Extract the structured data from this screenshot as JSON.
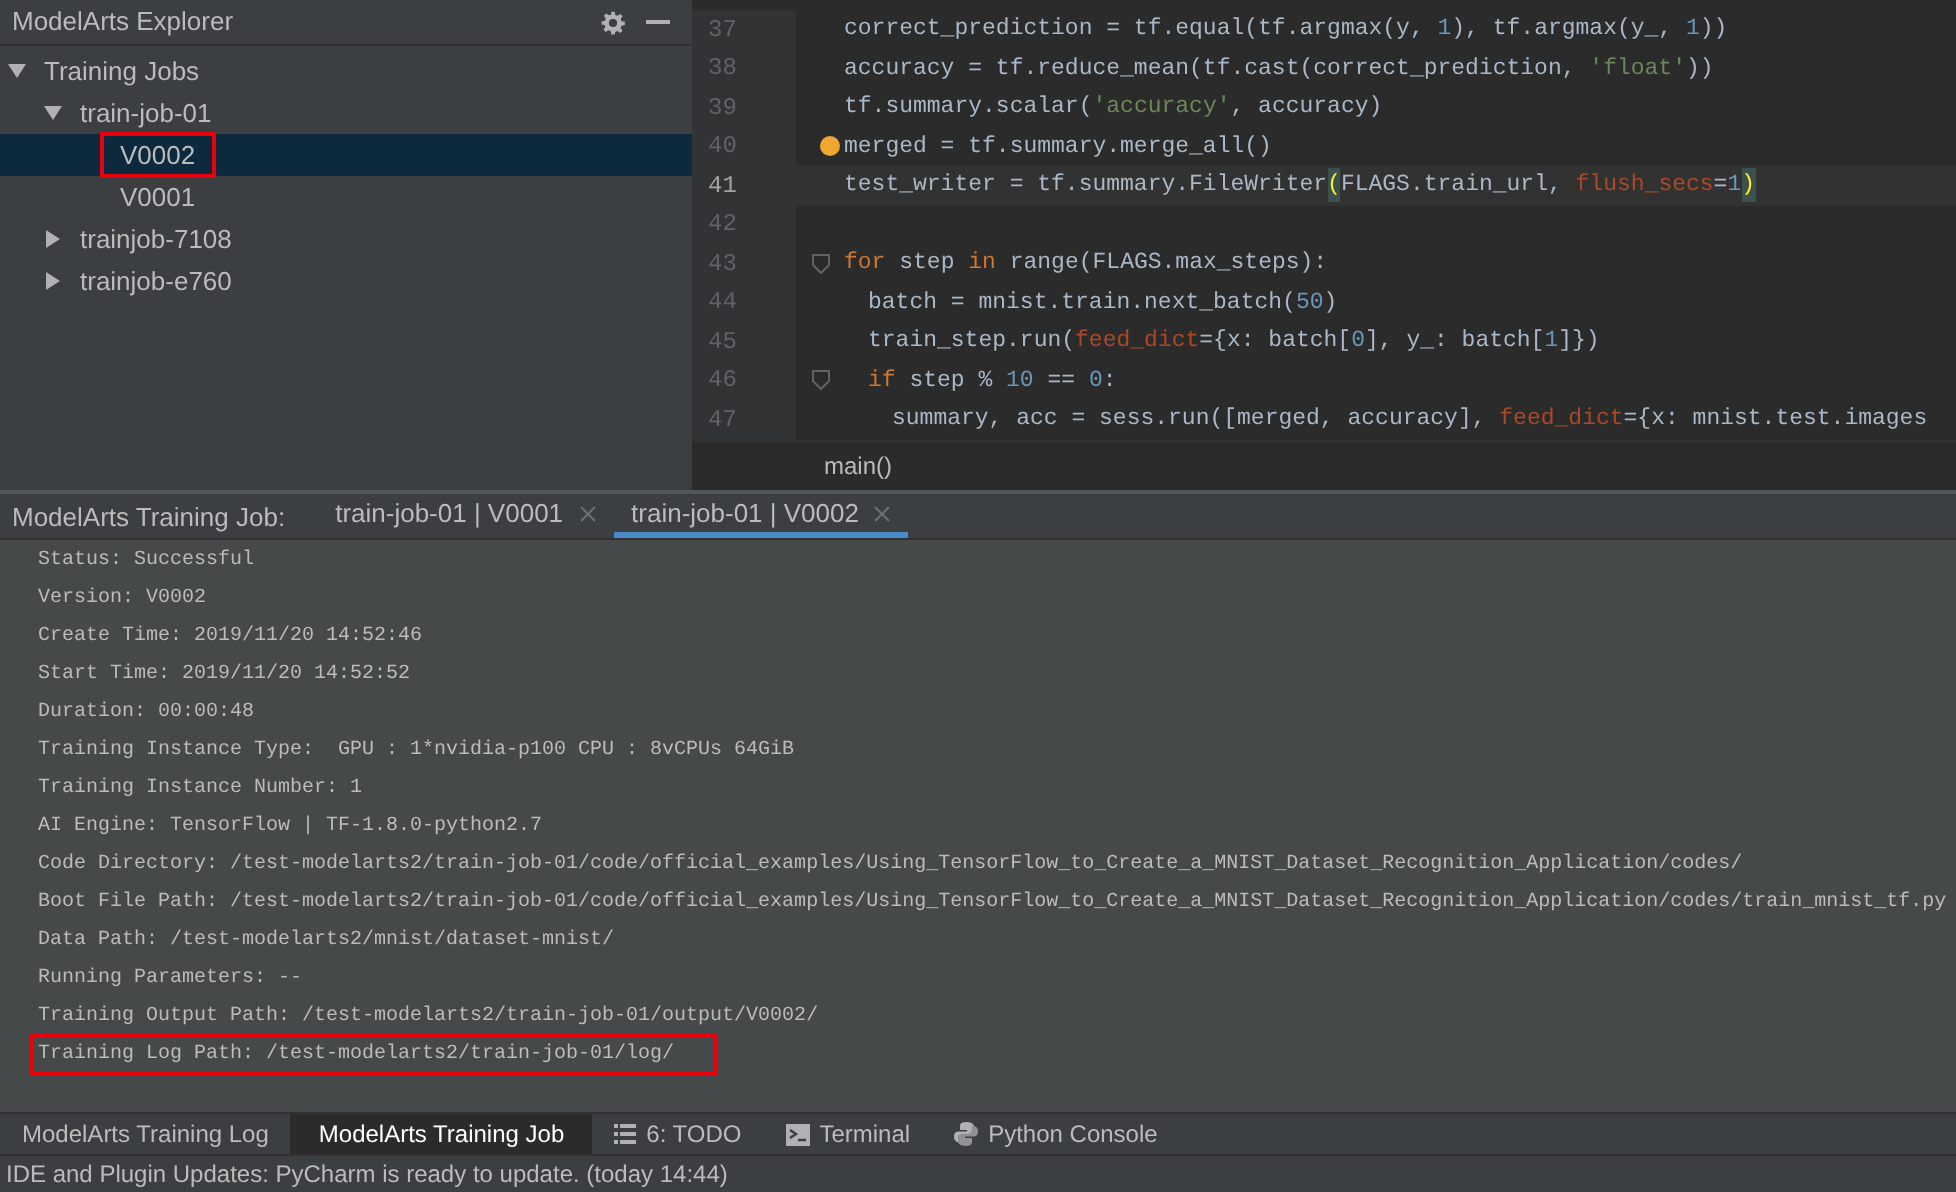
{
  "explorer": {
    "title": "ModelArts Explorer",
    "tree": [
      {
        "label": "Training Jobs",
        "expanded": true,
        "children": [
          {
            "label": "train-job-01",
            "expanded": true,
            "children": [
              {
                "label": "V0002",
                "selected": true,
                "annotated": true
              },
              {
                "label": "V0001",
                "selected": false,
                "annotated": false
              }
            ]
          },
          {
            "label": "trainjob-7108",
            "expanded": false
          },
          {
            "label": "trainjob-e760",
            "expanded": false
          }
        ]
      }
    ]
  },
  "editor": {
    "lines": [
      {
        "number": "37",
        "current": false,
        "bulb": false,
        "tokens": [
          {
            "kind": "plain",
            "text": "correct_prediction = tf.equal(tf.argmax(y, "
          },
          {
            "kind": "number",
            "text": "1"
          },
          {
            "kind": "plain",
            "text": "), tf.argmax(y_, "
          },
          {
            "kind": "number",
            "text": "1"
          },
          {
            "kind": "plain",
            "text": "))"
          }
        ]
      },
      {
        "number": "38",
        "current": false,
        "bulb": false,
        "tokens": [
          {
            "kind": "plain",
            "text": "accuracy = tf.reduce_mean(tf.cast(correct_prediction, "
          },
          {
            "kind": "string",
            "text": "'float'"
          },
          {
            "kind": "plain",
            "text": "))"
          }
        ]
      },
      {
        "number": "39",
        "current": false,
        "bulb": false,
        "tokens": [
          {
            "kind": "plain",
            "text": "tf.summary.scalar("
          },
          {
            "kind": "string",
            "text": "'accuracy'"
          },
          {
            "kind": "plain",
            "text": ", accuracy)"
          }
        ]
      },
      {
        "number": "40",
        "current": false,
        "bulb": true,
        "tokens": [
          {
            "kind": "plain",
            "text": "merged = tf.summary.merge_all()"
          }
        ]
      },
      {
        "number": "41",
        "current": true,
        "bulb": false,
        "tokens": [
          {
            "kind": "plain",
            "text": "test_writer = tf.summary.FileWriter"
          },
          {
            "kind": "brace",
            "text": "("
          },
          {
            "kind": "plain",
            "text": "FLAGS.train_url, "
          },
          {
            "kind": "param",
            "text": "flush_secs"
          },
          {
            "kind": "plain",
            "text": "="
          },
          {
            "kind": "number",
            "text": "1"
          },
          {
            "kind": "brace",
            "text": ")"
          }
        ]
      },
      {
        "number": "42",
        "current": false,
        "bulb": false
      },
      {
        "number": "43",
        "current": false,
        "bulb": false,
        "tokens": [
          {
            "kind": "keyword",
            "text": "for"
          },
          {
            "kind": "plain",
            "text": " step "
          },
          {
            "kind": "keyword",
            "text": "in"
          },
          {
            "kind": "plain",
            "text": " range(FLAGS.max_steps):"
          }
        ],
        "children": [
          {
            "number": "44",
            "current": false,
            "bulb": false,
            "tokens": [
              {
                "kind": "plain",
                "text": "batch = mnist.train.next_batch("
              },
              {
                "kind": "number",
                "text": "50"
              },
              {
                "kind": "plain",
                "text": ")"
              }
            ]
          },
          {
            "number": "45",
            "current": false,
            "bulb": false,
            "tokens": [
              {
                "kind": "plain",
                "text": "train_step.run("
              },
              {
                "kind": "param",
                "text": "feed_dict"
              },
              {
                "kind": "plain",
                "text": "={x: batch["
              },
              {
                "kind": "number",
                "text": "0"
              },
              {
                "kind": "plain",
                "text": "], y_: batch["
              },
              {
                "kind": "number",
                "text": "1"
              },
              {
                "kind": "plain",
                "text": "]})"
              }
            ]
          },
          {
            "number": "46",
            "current": false,
            "bulb": false,
            "tokens": [
              {
                "kind": "keyword",
                "text": "if"
              },
              {
                "kind": "plain",
                "text": " step % "
              },
              {
                "kind": "number",
                "text": "10"
              },
              {
                "kind": "plain",
                "text": " == "
              },
              {
                "kind": "number",
                "text": "0"
              },
              {
                "kind": "plain",
                "text": ":"
              }
            ],
            "children": [
              {
                "number": "47",
                "current": false,
                "bulb": false,
                "tokens": [
                  {
                    "kind": "plain",
                    "text": "summary, acc = sess.run([merged, accuracy], "
                  },
                  {
                    "kind": "param",
                    "text": "feed_dict"
                  },
                  {
                    "kind": "plain",
                    "text": "={x: mnist.test.images"
                  }
                ]
              }
            ]
          }
        ]
      }
    ],
    "breadcrumb": "main()"
  },
  "job_panel": {
    "title": "ModelArts Training Job:",
    "tabs": [
      {
        "label": "train-job-01 | V0001",
        "selected": false
      },
      {
        "label": "train-job-01 | V0002",
        "selected": true
      }
    ],
    "details": [
      {
        "text": "Status: Successful",
        "annotated": false
      },
      {
        "text": "Version: V0002",
        "annotated": false
      },
      {
        "text": "Create Time: 2019/11/20 14:52:46",
        "annotated": false
      },
      {
        "text": "Start Time: 2019/11/20 14:52:52",
        "annotated": false
      },
      {
        "text": "Duration: 00:00:48",
        "annotated": false
      },
      {
        "text": "Training Instance Type:  GPU : 1*nvidia-p100 CPU : 8vCPUs 64GiB",
        "annotated": false
      },
      {
        "text": "Training Instance Number: 1",
        "annotated": false
      },
      {
        "text": "AI Engine: TensorFlow | TF-1.8.0-python2.7",
        "annotated": false
      },
      {
        "text": "Code Directory: /test-modelarts2/train-job-01/code/official_examples/Using_TensorFlow_to_Create_a_MNIST_Dataset_Recognition_Application/codes/",
        "annotated": false
      },
      {
        "text": "Boot File Path: /test-modelarts2/train-job-01/code/official_examples/Using_TensorFlow_to_Create_a_MNIST_Dataset_Recognition_Application/codes/train_mnist_tf.py",
        "annotated": false
      },
      {
        "text": "Data Path: /test-modelarts2/mnist/dataset-mnist/",
        "annotated": false
      },
      {
        "text": "Running Parameters: --",
        "annotated": false
      },
      {
        "text": "Training Output Path: /test-modelarts2/train-job-01/output/V0002/",
        "annotated": false
      },
      {
        "text": "Training Log Path: /test-modelarts2/train-job-01/log/",
        "annotated": true
      }
    ]
  },
  "tool_tabs": [
    {
      "kind": "plain",
      "label": "ModelArts Training Log",
      "selected": false
    },
    {
      "kind": "plain",
      "label": "ModelArts Training Job",
      "selected": true
    },
    {
      "kind": "todo",
      "label": "6: TODO",
      "selected": false
    },
    {
      "kind": "terminal",
      "label": "Terminal",
      "selected": false
    },
    {
      "kind": "python",
      "label": "Python Console",
      "selected": false
    }
  ],
  "status_bar": "IDE and Plugin Updates: PyCharm is ready to update. (today 14:44)"
}
